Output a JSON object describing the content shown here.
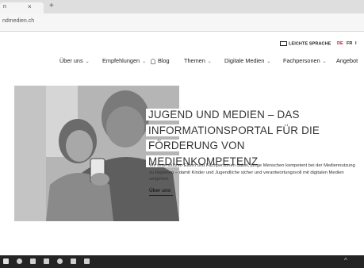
{
  "browser": {
    "tab_title": "n",
    "tab_close": "×",
    "new_tab": "+",
    "url": "ndmedien.ch"
  },
  "utility": {
    "easy_language": "LEICHTE SPRACHE",
    "languages": [
      "DE",
      "FR",
      "I"
    ],
    "active_language": "DE",
    "accent_color": "#c8102e"
  },
  "nav": {
    "items": [
      {
        "label": "Über uns",
        "dropdown": true
      },
      {
        "label": "Empfehlungen",
        "dropdown": true
      },
      {
        "label": "Blog",
        "dropdown": false,
        "icon": "lightbulb-icon"
      },
      {
        "label": "Themen",
        "dropdown": true
      },
      {
        "label": "Digitale Medien",
        "dropdown": true
      },
      {
        "label": "Fachpersonen",
        "dropdown": true
      },
      {
        "label": "Angebot",
        "dropdown": false
      }
    ],
    "chevron": "⌄"
  },
  "hero": {
    "headline_lines": [
      "JUGEND UND MEDIEN – DAS",
      "INFORMATIONSPORTAL FÜR DIE FÖRDERUNG VON",
      "MEDIENKOMPETENZ"
    ],
    "intro_text": "Wir unterstützen Eltern und Fachpersonen dabei, junge Menschen kompetent bei der Mediennutzung zu begleiten – damit Kinder und Jugendliche sicher und verantwortungsvoll mit digitalen Medien umgehen.",
    "cta_label": "Über uns"
  },
  "taskbar": {
    "icons": [
      "windows-start-icon",
      "search-icon",
      "task-view-icon",
      "file-explorer-icon",
      "browser-icon",
      "store-icon",
      "mail-icon"
    ],
    "tray_arrow": "^"
  }
}
